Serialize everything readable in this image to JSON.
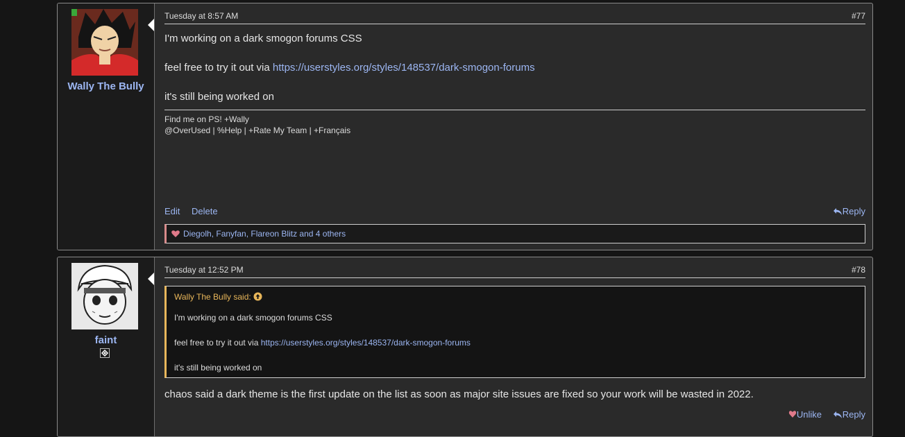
{
  "posts": [
    {
      "username": "Wally The Bully",
      "date": "Tuesday at 8:57 AM",
      "post_number": "#77",
      "message": [
        "I'm working on a dark smogon forums CSS",
        "feel free to try it out via ",
        "it's still being worked on"
      ],
      "link": "https://userstyles.org/styles/148537/dark-smogon-forums",
      "signature": [
        "Find me on PS! +Wally",
        "@OverUsed | %Help | +Rate My Team | +Français"
      ],
      "actions": {
        "edit": "Edit",
        "delete": "Delete",
        "reply": "Reply"
      },
      "reactions": "Diegolh, Fanyfan, Flareon Blitz and 4 others"
    },
    {
      "username": "faint",
      "date": "Tuesday at 12:52 PM",
      "post_number": "#78",
      "quote": {
        "author": "Wally The Bully said:",
        "lines": [
          "I'm working on a dark smogon forums CSS",
          "feel free to try it out via ",
          "it's still being worked on"
        ],
        "link": "https://userstyles.org/styles/148537/dark-smogon-forums"
      },
      "message": "chaos said a dark theme is the first update on the list as soon as major site issues are fixed so your work will be wasted in 2022.",
      "actions": {
        "unlike": "Unlike",
        "reply": "Reply"
      }
    }
  ],
  "colors": {
    "link": "#9cb6f2",
    "quote_accent": "#e8b65a",
    "reaction_accent": "#d88a8a"
  }
}
